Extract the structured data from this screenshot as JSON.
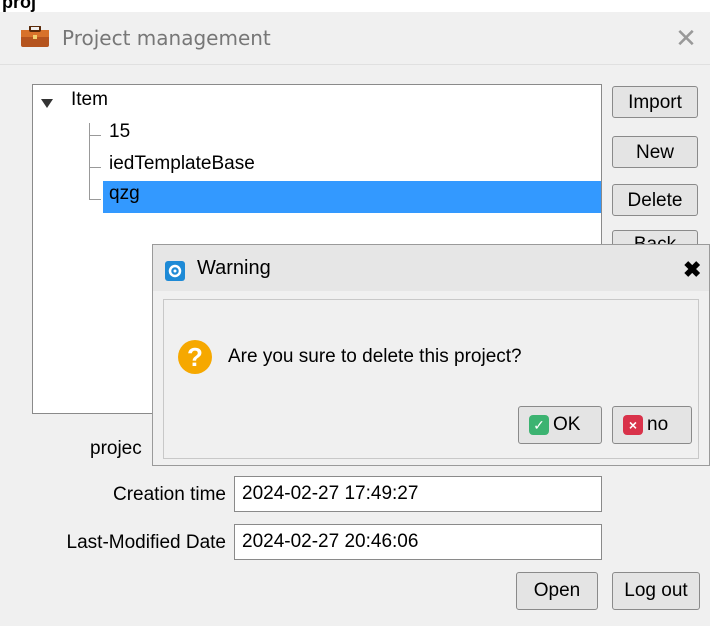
{
  "top_label": "proj",
  "window": {
    "title": "Project management",
    "close_glyph": "✕"
  },
  "tree": {
    "root": "Item",
    "children": [
      "15",
      "iedTemplateBase",
      "qzg"
    ],
    "selected": "qzg"
  },
  "side_buttons": {
    "import": "Import",
    "new": "New",
    "delete": "Delete",
    "back_partial": "Back"
  },
  "form": {
    "project_label_partial": "projec",
    "creation_time_label": "Creation time",
    "creation_time_value": "2024-02-27 17:49:27",
    "last_modified_label": "Last-Modified Date",
    "last_modified_value": "2024-02-27 20:46:06"
  },
  "bottom_buttons": {
    "open": "Open",
    "log_out": "Log out"
  },
  "dialog": {
    "title": "Warning",
    "close_glyph": "✖",
    "message": "Are you sure to delete this project?",
    "ok_label": "OK",
    "no_label": "no",
    "question_glyph": "?"
  },
  "colors": {
    "selection": "#3399ff",
    "question_icon": "#f6a800",
    "ok_badge": "#3cb371",
    "no_badge": "#d9324a",
    "dialog_icon": "#1e8ad6"
  },
  "icons": [
    "briefcase-icon",
    "close-icon",
    "tree-expand-triangle-icon",
    "gear-icon",
    "question-icon",
    "check-icon",
    "x-icon"
  ]
}
